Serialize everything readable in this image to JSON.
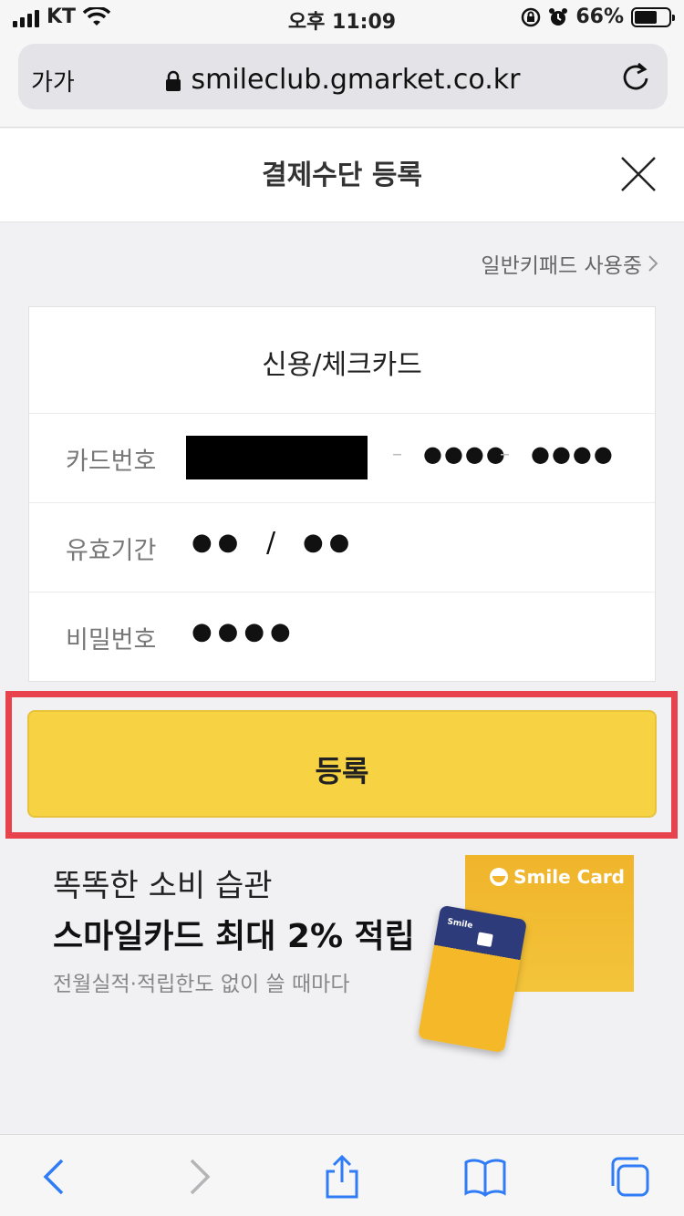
{
  "status_bar": {
    "carrier": "KT",
    "time": "오후 11:09",
    "battery": "66%",
    "battery_level": 0.66
  },
  "address_bar": {
    "text_size_label": "가가",
    "url": "smileclub.gmarket.co.kr"
  },
  "header": {
    "title": "결제수단 등록"
  },
  "keypad_link": {
    "label": "일반키패드 사용중"
  },
  "form": {
    "card_type": "신용/체크카드",
    "card_number": {
      "label": "카드번호",
      "separator": "–",
      "group3": "●●●●",
      "group4": "●●●●"
    },
    "expiry": {
      "label": "유효기간",
      "month": "●●",
      "slash": "/",
      "year": "●●"
    },
    "password": {
      "label": "비밀번호",
      "value": "●●●●"
    }
  },
  "register_button": {
    "label": "등록"
  },
  "promo": {
    "line1": "똑똑한 소비 습관",
    "line2": "스마일카드 최대 2% 적립",
    "line3": "전월실적·적립한도 없이 쓸 때마다",
    "brand": "Smile Card",
    "card_brand": "Smile"
  },
  "colors": {
    "accent": "#f7d344",
    "highlight": "#e8434d",
    "link_blue": "#2f7cf6"
  },
  "toolbar": {
    "icons": [
      "back-icon",
      "forward-icon",
      "share-icon",
      "bookmarks-icon",
      "tabs-icon"
    ]
  }
}
